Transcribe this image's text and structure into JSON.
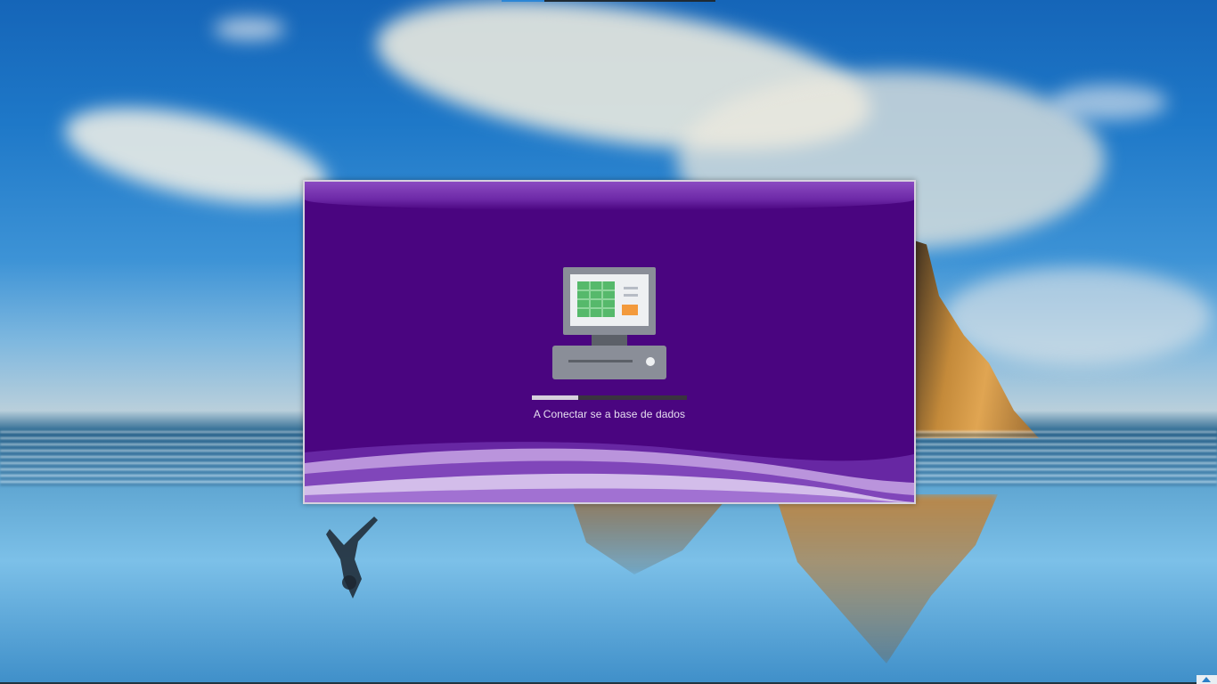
{
  "splash": {
    "status_text": "A Conectar se a base de dados",
    "progress": 0.3,
    "colors": {
      "background": "#4a0580",
      "border": "#d6d2de",
      "progress_fill": "#d7d1dd",
      "progress_track": "#3a3340",
      "text": "#e6def0"
    },
    "illustration_icon": "pos-terminal-icon"
  },
  "desktop": {
    "wallpaper": "beach-with-cliff-and-clouds"
  },
  "taskbar": {
    "tray_icon": "chevron-up-icon"
  }
}
